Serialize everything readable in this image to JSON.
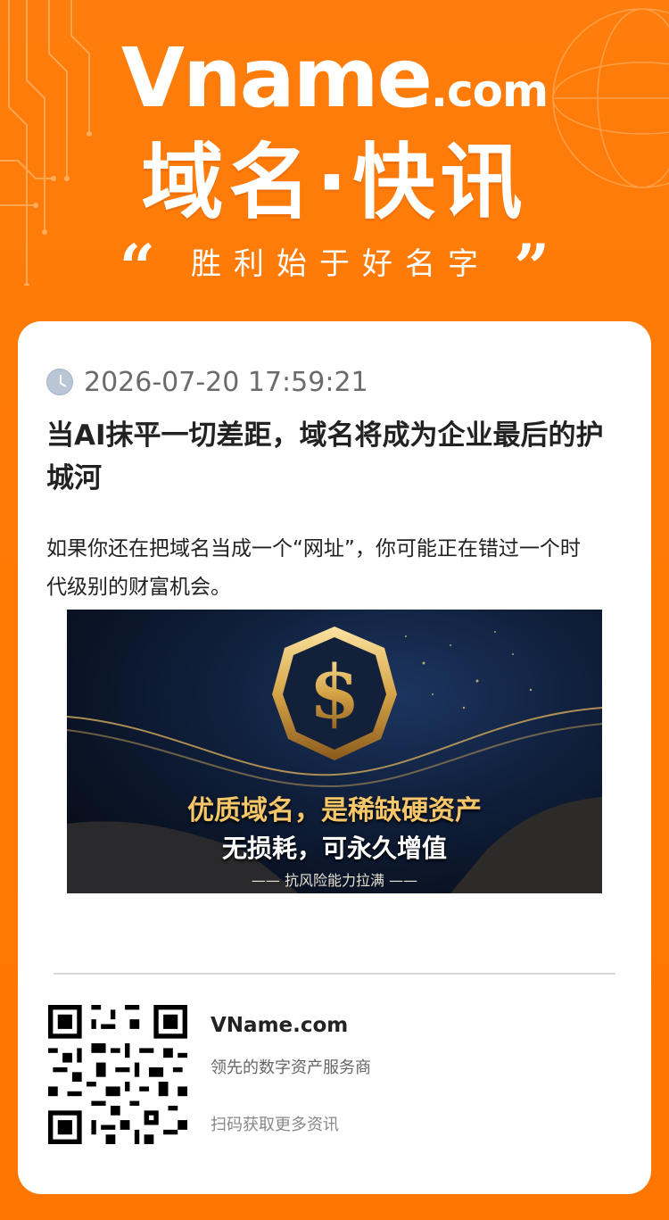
{
  "header": {
    "logo_main": "Vname",
    "logo_suffix": ".com",
    "title": "域名·快讯",
    "slogan": "胜利始于好名字",
    "quote_open": "“",
    "quote_close": "”"
  },
  "article": {
    "date": "2026-07-20 17:59:21",
    "title": "当AI抹平一切差距，域名将成为企业最后的护城河",
    "summary": "如果你还在把域名当成一个“网址”，你可能正在错过一个时代级别的财富机会。",
    "banner": {
      "line1": "优质域名，是稀缺硬资产",
      "line2": "无损耗，可永久增值",
      "line3": "—— 抗风险能力拉满 ——",
      "icon": "dollar-shield-icon"
    }
  },
  "footer": {
    "site": "VName.com",
    "tagline": "领先的数字资产服务商",
    "cta": "扫码获取更多资讯",
    "qr_icon": "qr-code-icon"
  },
  "colors": {
    "background": "#ff7a06",
    "card": "#ffffff",
    "title_text": "#222222",
    "date_text": "#6b6b6b",
    "banner_gold": "#f5c76a"
  }
}
